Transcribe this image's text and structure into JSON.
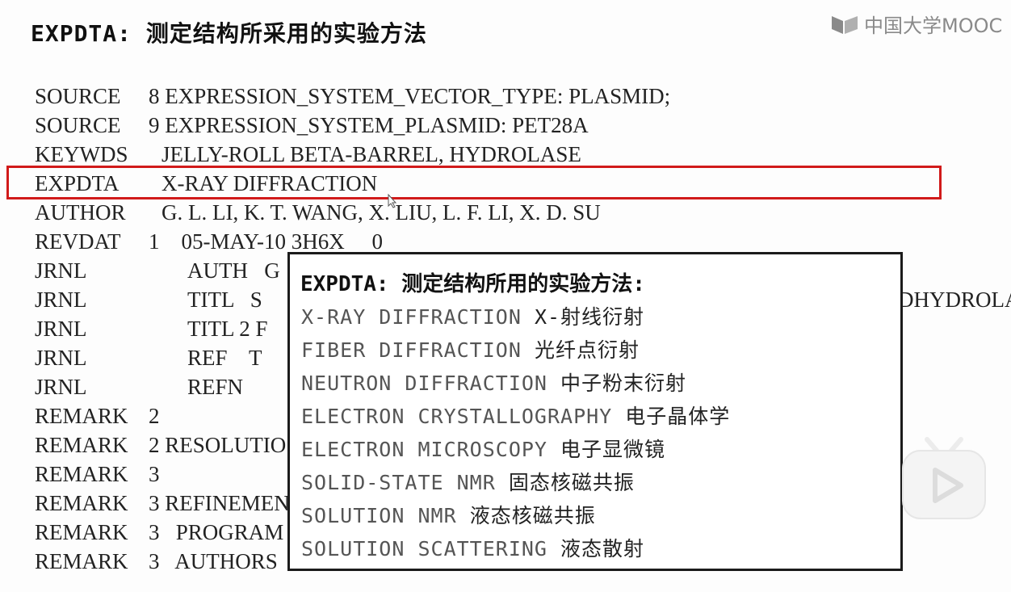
{
  "slide": {
    "title": "EXPDTA: 测定结构所采用的实验方法"
  },
  "brand": {
    "logo_text": "中国大学MOOC",
    "logo_icon": "mooc-book-icon"
  },
  "pdb_record": {
    "lines": [
      {
        "record": "SOURCE",
        "rest": "8 EXPRESSION_SYSTEM_VECTOR_TYPE: PLASMID;"
      },
      {
        "record": "SOURCE",
        "rest": "9 EXPRESSION_SYSTEM_PLASMID: PET28A"
      },
      {
        "record": "KEYWDS",
        "rest": "JELLY-ROLL BETA-BARREL, HYDROLASE"
      },
      {
        "record": "EXPDTA",
        "rest": "X-RAY DIFFRACTION"
      },
      {
        "record": "AUTHOR",
        "rest": "G. L. LI, K. T. WANG, X. LIU, L. F. LI, X. D. SU"
      },
      {
        "record": "REVDAT",
        "rest": "1    05-MAY-10 3H6X     0"
      },
      {
        "record": "JRNL",
        "rest": "AUTH   G"
      },
      {
        "record": "JRNL",
        "rest": "TITL   S",
        "tail": "DHYDROLA"
      },
      {
        "record": "JRNL",
        "rest": "TITL 2 F"
      },
      {
        "record": "JRNL",
        "rest": "REF    T"
      },
      {
        "record": "JRNL",
        "rest": "REFN"
      },
      {
        "record": "REMARK",
        "rest": "2"
      },
      {
        "record": "REMARK",
        "rest": "2 RESOLUTIO"
      },
      {
        "record": "REMARK",
        "rest": "3"
      },
      {
        "record": "REMARK",
        "rest": "3 REFINEMEN"
      },
      {
        "record": "REMARK",
        "rest": "3   PROGRAM"
      },
      {
        "record": "REMARK",
        "rest": "3   AUTHORS"
      }
    ]
  },
  "popup": {
    "title": "EXPDTA: 测定结构所用的实验方法:",
    "methods": [
      {
        "en": "X-RAY DIFFRACTION",
        "zh": "X-射线衍射"
      },
      {
        "en": "FIBER DIFFRACTION",
        "zh": "光纤点衍射"
      },
      {
        "en": "NEUTRON DIFFRACTION",
        "zh": "中子粉末衍射"
      },
      {
        "en": "ELECTRON CRYSTALLOGRAPHY",
        "zh": "电子晶体学"
      },
      {
        "en": "ELECTRON MICROSCOPY",
        "zh": "电子显微镜"
      },
      {
        "en": "SOLID-STATE NMR",
        "zh": "固态核磁共振"
      },
      {
        "en": "SOLUTION NMR",
        "zh": "液态核磁共振"
      },
      {
        "en": "SOLUTION SCATTERING",
        "zh": "液态散射"
      }
    ]
  },
  "player": {
    "play_icon": "play-icon"
  },
  "colors": {
    "highlight": "#d11a1a",
    "popup_border": "#1b1b1b",
    "text": "#222222"
  }
}
